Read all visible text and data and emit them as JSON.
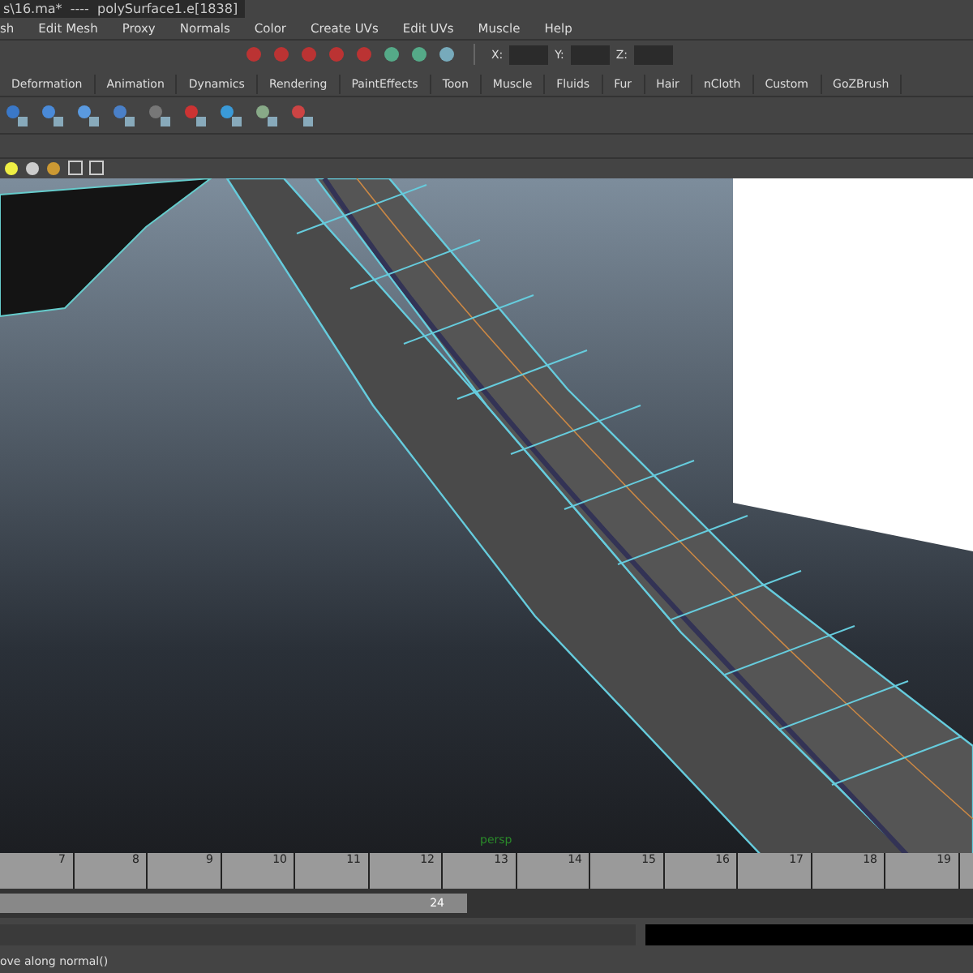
{
  "window": {
    "title": "s\\16.ma*  ----  polySurface1.e[1838]"
  },
  "menu": [
    "sh",
    "Edit Mesh",
    "Proxy",
    "Normals",
    "Color",
    "Create UVs",
    "Edit UVs",
    "Muscle",
    "Help"
  ],
  "status_line": {
    "coords": [
      "X:",
      "Y:",
      "Z:"
    ]
  },
  "shelf_tabs": [
    {
      "label": "Deformation",
      "selected": false
    },
    {
      "label": "Animation",
      "selected": false
    },
    {
      "label": "Dynamics",
      "selected": false
    },
    {
      "label": "Rendering",
      "selected": false
    },
    {
      "label": "PaintEffects",
      "selected": false
    },
    {
      "label": "Toon",
      "selected": false
    },
    {
      "label": "Muscle",
      "selected": false
    },
    {
      "label": "Fluids",
      "selected": false
    },
    {
      "label": "Fur",
      "selected": false
    },
    {
      "label": "Hair",
      "selected": false
    },
    {
      "label": "nCloth",
      "selected": false
    },
    {
      "label": "Custom",
      "selected": false
    },
    {
      "label": "GoZBrush",
      "selected": false
    }
  ],
  "viewport": {
    "camera": "persp"
  },
  "timeline": {
    "ticks": [
      "7",
      "8",
      "9",
      "10",
      "11",
      "12",
      "13",
      "14",
      "15",
      "16",
      "17",
      "18",
      "19"
    ]
  },
  "range": {
    "end": "24",
    "level": 0.48
  },
  "help_line": "ove along normal()"
}
